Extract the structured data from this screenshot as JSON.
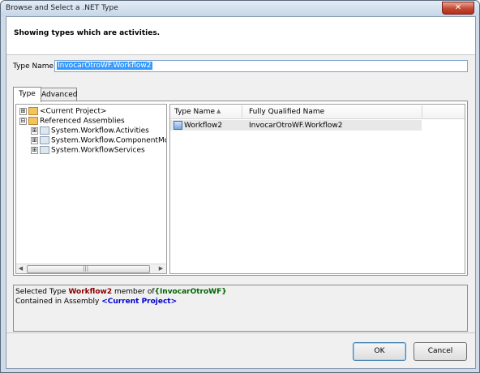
{
  "window": {
    "title": "Browse and Select a .NET Type",
    "close_glyph": "✕"
  },
  "header": {
    "text": "Showing types which are activities."
  },
  "type_name": {
    "label": "Type Name:",
    "value": "InvocarOtroWF.Workflow2"
  },
  "tabs": [
    {
      "label": "Type"
    },
    {
      "label": "Advanced"
    }
  ],
  "tree": {
    "items": [
      {
        "expander": "⊞",
        "label": "<Current Project>",
        "icon": "project-folder-icon"
      },
      {
        "expander": "⊟",
        "label": "Referenced Assemblies",
        "icon": "folder-icon"
      },
      {
        "expander": "⊞",
        "label": "System.Workflow.Activities",
        "icon": "assembly-icon"
      },
      {
        "expander": "⊞",
        "label": "System.Workflow.ComponentModel",
        "icon": "assembly-icon"
      },
      {
        "expander": "⊞",
        "label": "System.WorkflowServices",
        "icon": "assembly-icon"
      }
    ],
    "scroll_left": "◀",
    "scroll_right": "▶",
    "scroll_grip": "|||"
  },
  "list": {
    "columns": [
      "Type Name",
      "Fully Qualified Name"
    ],
    "sort_glyph": "▲",
    "rows": [
      {
        "type_name": "Workflow2",
        "fqn": "InvocarOtroWF.Workflow2"
      }
    ]
  },
  "status": {
    "line1_prefix": "Selected Type",
    "line1_type": "Workflow2",
    "line1_mid": "member of",
    "line1_ns": "{InvocarOtroWF}",
    "line2_prefix": "Contained in Assembly",
    "line2_asm": "<Current Project>"
  },
  "buttons": {
    "ok": "OK",
    "cancel": "Cancel"
  },
  "colors": {
    "selection": "#3399ff",
    "type_highlight": "#8b0000",
    "namespace_highlight": "#006400",
    "assembly_highlight": "#0000cd"
  }
}
